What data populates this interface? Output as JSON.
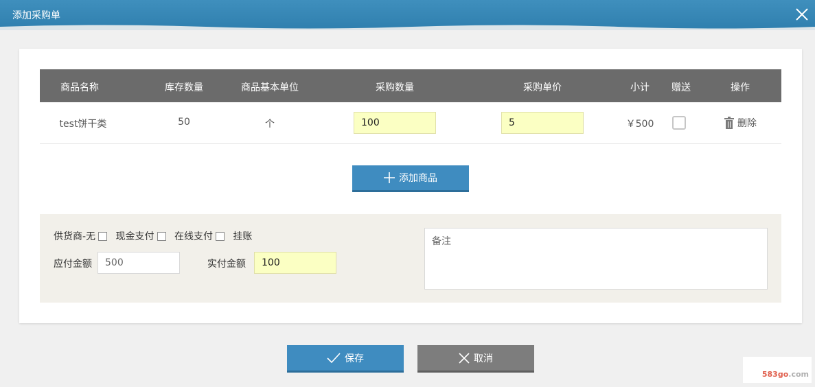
{
  "dialog": {
    "title": "添加采购单",
    "close_icon": "close-icon"
  },
  "table": {
    "headers": [
      "商品名称",
      "库存数量",
      "商品基本单位",
      "采购数量",
      "采购单价",
      "小计",
      "赠送",
      "操作"
    ],
    "rows": [
      {
        "name": "test饼干类",
        "stock": "50",
        "unit": "个",
        "qty": "100",
        "price": "5",
        "subtotal": "￥500",
        "gift": false,
        "delete_label": "删除"
      }
    ]
  },
  "add_button": {
    "label": "添加商品",
    "icon": "plus-icon"
  },
  "payment": {
    "supplier_label": "供货商-无",
    "cash_label": "现金支付",
    "online_label": "在线支付",
    "credit_label": "挂账",
    "payable_label": "应付金额",
    "payable_value": "500",
    "paid_label": "实付金额",
    "paid_value": "100",
    "remark_placeholder": "备注"
  },
  "footer": {
    "save_label": "保存",
    "cancel_label": "取消"
  },
  "watermark": {
    "prefix": "583go",
    "suffix": ".com"
  },
  "colors": {
    "accent": "#3f8cc0",
    "header_bg": "#6b6b6b",
    "highlight_input": "#fbffc3",
    "cancel": "#7d7d7d"
  }
}
